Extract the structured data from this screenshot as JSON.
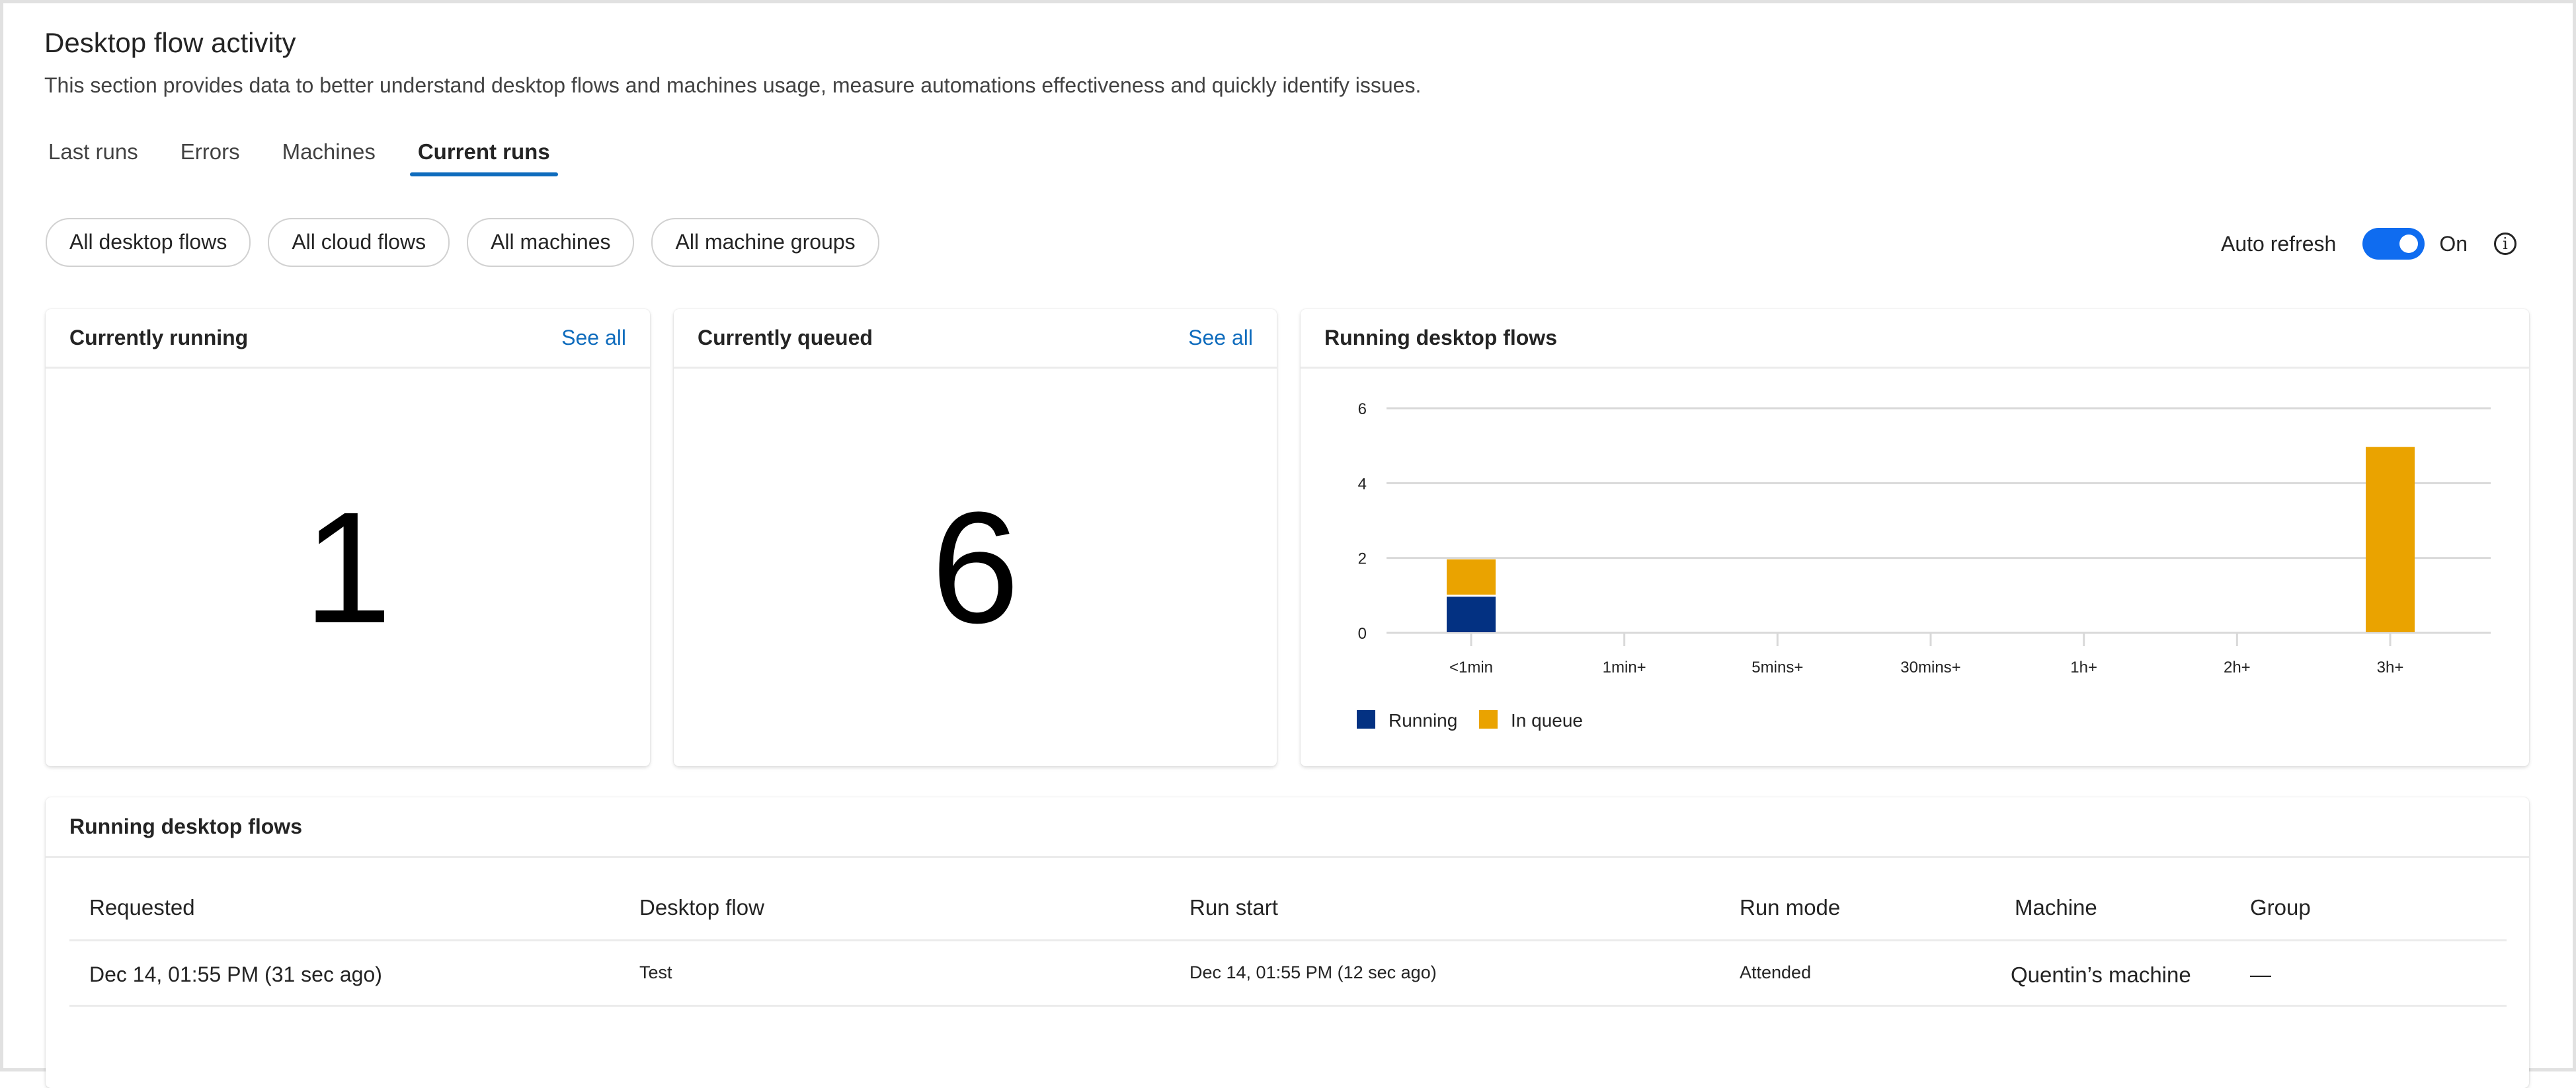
{
  "header": {
    "title": "Desktop flow activity",
    "subtitle": "This section provides data to better understand desktop flows and machines usage, measure automations effectiveness and quickly identify issues."
  },
  "tabs": [
    {
      "label": "Last runs",
      "active": false
    },
    {
      "label": "Errors",
      "active": false
    },
    {
      "label": "Machines",
      "active": false
    },
    {
      "label": "Current runs",
      "active": true
    }
  ],
  "filters": [
    "All desktop flows",
    "All cloud flows",
    "All machines",
    "All machine groups"
  ],
  "auto_refresh": {
    "label": "Auto refresh",
    "state_label": "On",
    "enabled": true,
    "info_icon": "info-icon"
  },
  "cards": {
    "running": {
      "title": "Currently running",
      "link": "See all",
      "value": "1"
    },
    "queued": {
      "title": "Currently queued",
      "link": "See all",
      "value": "6"
    },
    "chart": {
      "title": "Running desktop flows"
    }
  },
  "colors": {
    "accent": "#0f6cbd",
    "toggle": "#0f6cf0",
    "running": "#033182",
    "in_queue": "#eaa300"
  },
  "chart_data": {
    "type": "bar",
    "stacked": true,
    "title": "Running desktop flows",
    "categories": [
      "<1min",
      "1min+",
      "5mins+",
      "30mins+",
      "1h+",
      "2h+",
      "3h+"
    ],
    "series": [
      {
        "name": "Running",
        "color": "#033182",
        "values": [
          1,
          0,
          0,
          0,
          0,
          0,
          0
        ]
      },
      {
        "name": "In queue",
        "color": "#eaa300",
        "values": [
          1,
          0,
          0,
          0,
          0,
          0,
          5
        ]
      }
    ],
    "yticks": [
      0,
      2,
      4,
      6
    ],
    "ylim": [
      0,
      6
    ],
    "xlabel": "",
    "ylabel": "",
    "grid": true,
    "legend": "bottom-left"
  },
  "table": {
    "title": "Running desktop flows",
    "columns": [
      "Requested",
      "Desktop flow",
      "Run start",
      "Run mode",
      "Machine",
      "Group"
    ],
    "rows": [
      [
        "Dec 14, 01:55 PM (31 sec ago)",
        "Test",
        "Dec 14, 01:55 PM (12 sec ago)",
        "Attended",
        "Quentin’s machine",
        "—"
      ]
    ]
  }
}
